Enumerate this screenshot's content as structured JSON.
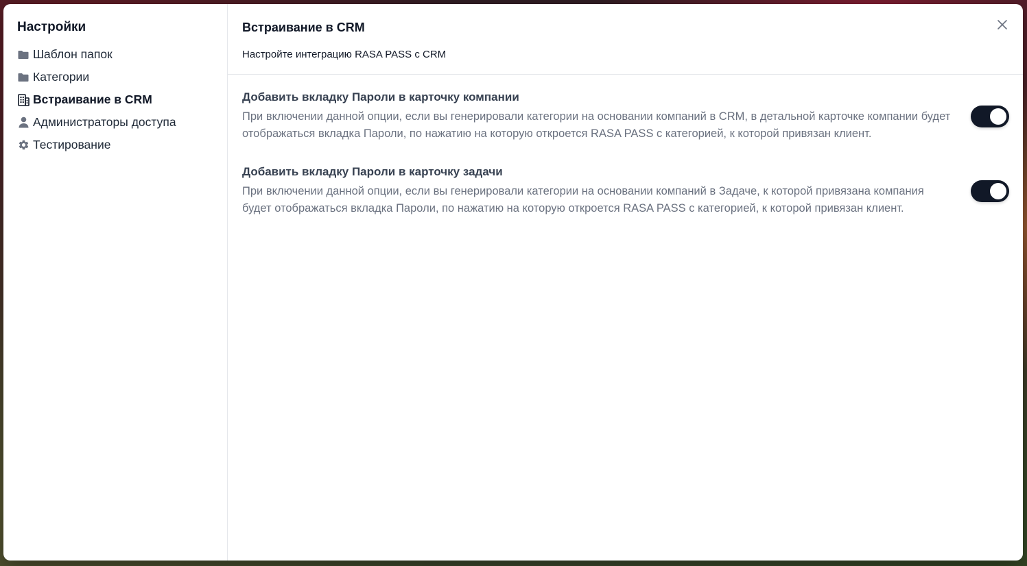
{
  "sidebar": {
    "title": "Настройки",
    "items": [
      {
        "label": "Шаблон папок",
        "icon": "folder-icon",
        "active": false
      },
      {
        "label": "Категории",
        "icon": "folder-icon",
        "active": false
      },
      {
        "label": "Встраивание в CRM",
        "icon": "building-icon",
        "active": true
      },
      {
        "label": "Администраторы доступа",
        "icon": "user-icon",
        "active": false
      },
      {
        "label": "Тестирование",
        "icon": "gear-icon",
        "active": false
      }
    ]
  },
  "main": {
    "title": "Встраивание в CRM",
    "subtitle": "Настройте интеграцию RASA PASS с CRM",
    "close_icon": "close-icon",
    "settings": [
      {
        "title": "Добавить вкладку Пароли в карточку компании",
        "description": "При включении данной опции, если вы генерировали категории на основании компаний в CRM, в детальной карточке компании будет отображаться вкладка Пароли, по нажатию на которую откроется RASA PASS с категорией, к которой привязан клиент.",
        "enabled": true
      },
      {
        "title": "Добавить вкладку Пароли в карточку задачи",
        "description": "При включении данной опции, если вы генерировали категории на основании компаний в Задаче, к которой привязана компания будет отображаться вкладка Пароли, по нажатию на которую откроется RASA PASS с категорией, к которой привязан клиент.",
        "enabled": true
      }
    ]
  },
  "colors": {
    "toggle_on": "#111827",
    "text_primary": "#111827",
    "text_muted": "#6b7280",
    "divider": "#e5e7eb"
  }
}
